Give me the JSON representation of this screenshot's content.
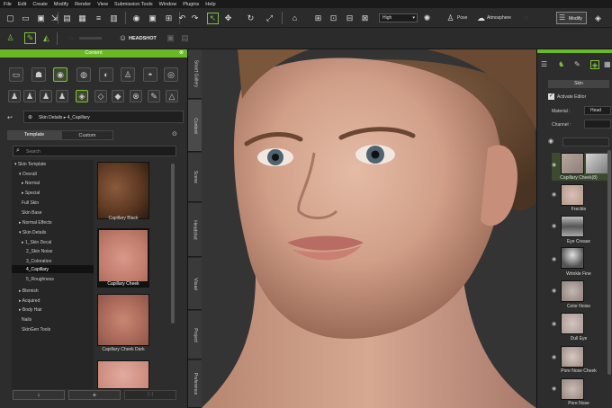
{
  "menu": [
    "File",
    "Edit",
    "Create",
    "Modify",
    "Render",
    "View",
    "Submission Tools",
    "Window",
    "Plugins",
    "Help"
  ],
  "toolbar": {
    "quality_value": "High",
    "pose_label": "Pose",
    "atmosphere_label": "Atmosphere",
    "modify_label": "Modify",
    "headshot_label": "HEADSHOT"
  },
  "content_panel": {
    "title": "Content",
    "breadcrumb": "Skin Details ▸ 4_Capillary",
    "tabs": [
      "Template",
      "Custom"
    ],
    "search_placeholder": "Search",
    "tree": [
      "▾ Skin Template",
      "▾ Overall",
      "▸ Normal",
      "▸ Special",
      "Full Skin",
      "Skin Base",
      "▸ Normal Effects",
      "▾ Skin Details",
      "▸ 1_Skin Decal",
      "2_Skin Noise",
      "3_Coloration",
      "4_Capillary",
      "5_Roughness",
      "▸ Blemish",
      "▸ Acquired",
      "▸ Body Hair",
      "Nails",
      "SkinGen Tools"
    ],
    "thumbnails": [
      "Capillary Black",
      "Capillary Cheek",
      "Capillary Cheek Dark",
      ""
    ]
  },
  "side_tabs": [
    "Smart Gallery",
    "Content",
    "Scene",
    "Headshot",
    "Visual",
    "Project",
    "Preference"
  ],
  "modify_panel": {
    "section_label": "Skin",
    "activate_editor_label": "Activate Editor",
    "material_label": "Material :",
    "material_value": "Head",
    "channel_label": "Channel :",
    "layers": [
      "Capillary Cheek(8)",
      "Freckle",
      "Eye Crease",
      "Wrinkle Fine",
      "Color Noise",
      "Dull Eye",
      "Pore Nose Cheek",
      "Pore Nose"
    ]
  },
  "colors": {
    "accent": "#7ec13a",
    "panel": "#2d2d2d",
    "header_green": "#6bb826"
  }
}
